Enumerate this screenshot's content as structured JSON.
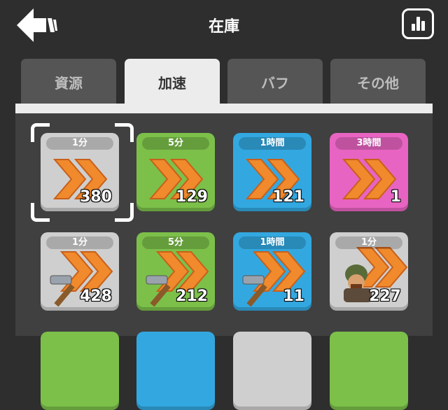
{
  "header": {
    "title": "在庫"
  },
  "tabs": [
    {
      "label": "資源",
      "active": false
    },
    {
      "label": "加速",
      "active": true
    },
    {
      "label": "バフ",
      "active": false
    },
    {
      "label": "その他",
      "active": false
    }
  ],
  "items": [
    {
      "label": "1分",
      "count": "380",
      "color": "gray",
      "icon": "speedup-icon"
    },
    {
      "label": "5分",
      "count": "129",
      "color": "green",
      "icon": "speedup-icon"
    },
    {
      "label": "1時間",
      "count": "121",
      "color": "blue",
      "icon": "speedup-icon"
    },
    {
      "label": "3時間",
      "count": "1",
      "color": "pink",
      "icon": "speedup-icon"
    },
    {
      "label": "1分",
      "count": "428",
      "color": "gray",
      "icon": "build-speedup-icon"
    },
    {
      "label": "5分",
      "count": "212",
      "color": "green",
      "icon": "build-speedup-icon"
    },
    {
      "label": "1時間",
      "count": "11",
      "color": "blue",
      "icon": "build-speedup-icon"
    },
    {
      "label": "1分",
      "count": "227",
      "color": "gray",
      "icon": "training-speedup-icon"
    }
  ],
  "colors": {
    "background": "#2e2e2e",
    "tab_active": "#ececec",
    "tab_inactive": "#555555",
    "green": "#7cc04a",
    "blue": "#33a8e0",
    "pink": "#e864c2",
    "gray": "#cfcfcf",
    "arrow": "#f08a2c"
  }
}
